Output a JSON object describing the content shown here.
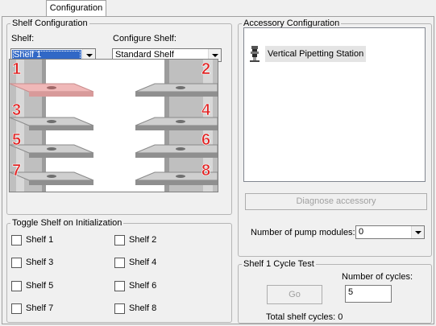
{
  "tabs": [
    {
      "label": "Configuration"
    }
  ],
  "shelf_config": {
    "title": "Shelf Configuration",
    "shelf_label": "Shelf:",
    "shelf_value": "Shelf 1",
    "configure_label": "Configure Shelf:",
    "configure_value": "Standard Shelf",
    "image": {
      "shelf_numbers": [
        "1",
        "2",
        "3",
        "4",
        "5",
        "6",
        "7",
        "8"
      ],
      "selected_shelf": "1",
      "highlight_color": "#f0b8b8",
      "number_color": "#e02020"
    }
  },
  "toggle_init": {
    "title": "Toggle Shelf on Initialization",
    "items": [
      {
        "label": "Shelf 1",
        "checked": false
      },
      {
        "label": "Shelf 2",
        "checked": false
      },
      {
        "label": "Shelf 3",
        "checked": false
      },
      {
        "label": "Shelf 4",
        "checked": false
      },
      {
        "label": "Shelf 5",
        "checked": false
      },
      {
        "label": "Shelf 6",
        "checked": false
      },
      {
        "label": "Shelf 7",
        "checked": false
      },
      {
        "label": "Shelf 8",
        "checked": false
      }
    ]
  },
  "accessory": {
    "title": "Accessory Configuration",
    "items": [
      {
        "label": "Vertical Pipetting Station",
        "icon": "pipetting-station-icon"
      }
    ],
    "diagnose_label": "Diagnose accessory",
    "pump_label": "Number of pump modules:",
    "pump_value": "0"
  },
  "cycle_test": {
    "title": "Shelf 1 Cycle Test",
    "go_label": "Go",
    "cycles_label": "Number of cycles:",
    "cycles_value": "5",
    "total_label": "Total shelf cycles: 0"
  },
  "colors": {
    "window_bg": "#f0f0f0",
    "selection": "#3168c6",
    "disabled_text": "#a0a0a0"
  }
}
